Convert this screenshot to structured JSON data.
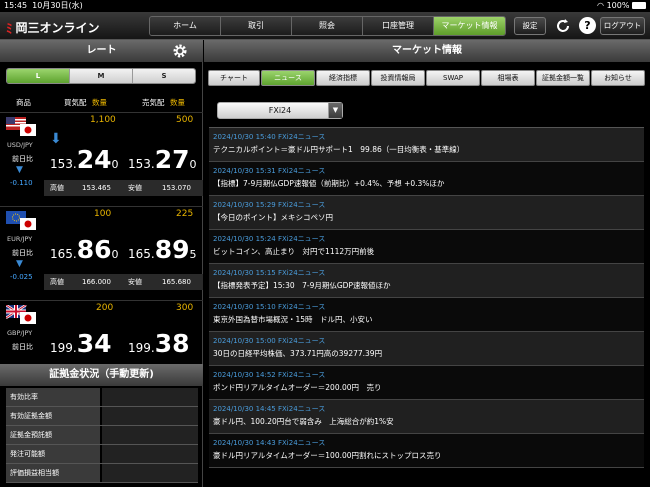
{
  "status_bar": {
    "time": "15:45",
    "date": "10月30日(水)",
    "battery": "100%"
  },
  "app": {
    "logo_text": "岡三オンライン"
  },
  "nav": {
    "tabs": [
      "ホーム",
      "取引",
      "照会",
      "口座管理",
      "マーケット情報"
    ],
    "active": "マーケット情報",
    "settings_label": "設定",
    "logout_label": "ログアウト"
  },
  "rate_panel": {
    "title": "レート",
    "size_tabs": [
      "L",
      "M",
      "S"
    ],
    "active_size": "L",
    "headers": {
      "product": "商品",
      "buy": "買気配",
      "buy_qty": "数量",
      "sell": "売気配",
      "sell_qty": "数量"
    },
    "pairs": [
      {
        "name": "USD/JPY",
        "zenjitsu": "前日比",
        "change": "-0.110",
        "buy_qty": "1,100",
        "sell_qty": "500",
        "buy": {
          "a": "153.",
          "b": "24",
          "c": "0"
        },
        "sell": {
          "a": "153.",
          "b": "27",
          "c": "0"
        },
        "high_label": "高値",
        "high": "153.465",
        "low_label": "安値",
        "low": "153.070"
      },
      {
        "name": "EUR/JPY",
        "zenjitsu": "前日比",
        "change": "-0.025",
        "buy_qty": "100",
        "sell_qty": "225",
        "buy": {
          "a": "165.",
          "b": "86",
          "c": "0"
        },
        "sell": {
          "a": "165.",
          "b": "89",
          "c": "5"
        },
        "high_label": "高値",
        "high": "166.000",
        "low_label": "安値",
        "low": "165.680"
      },
      {
        "name": "GBP/JPY",
        "zenjitsu": "前日比",
        "change": "",
        "buy_qty": "200",
        "sell_qty": "300",
        "buy": {
          "a": "199.",
          "b": "34",
          "c": ""
        },
        "sell": {
          "a": "199.",
          "b": "38",
          "c": ""
        }
      }
    ]
  },
  "margin_panel": {
    "title": "証拠金状況（手動更新)",
    "rows": [
      "有効比率",
      "有効証拠金額",
      "証拠金預託額",
      "発注可能額",
      "評価損益相当額"
    ]
  },
  "market": {
    "title": "マーケット情報",
    "subtabs": [
      "チャート",
      "ニュース",
      "経済指標",
      "投資情報局",
      "SWAP",
      "相場表",
      "証拠金額一覧",
      "お知らせ"
    ],
    "active_subtab": "ニュース",
    "source_select": "FXi24",
    "news": [
      {
        "meta": "2024/10/30 15:40 FXi24ニュース",
        "title": "テクニカルポイント＝豪ドル円サポート1　99.86（一目均衡表・基準線）"
      },
      {
        "meta": "2024/10/30 15:31 FXi24ニュース",
        "title": "【指標】7-9月期仏GDP速報値（前期比）+0.4%、予想 +0.3%ほか"
      },
      {
        "meta": "2024/10/30 15:29 FXi24ニュース",
        "title": "【今日のポイント】メキシコペソ円"
      },
      {
        "meta": "2024/10/30 15:24 FXi24ニュース",
        "title": "ビットコイン、高止まり　対円で1112万円前後"
      },
      {
        "meta": "2024/10/30 15:15 FXi24ニュース",
        "title": "【指標発表予定】15:30　7-9月期仏GDP速報値ほか"
      },
      {
        "meta": "2024/10/30 15:10 FXi24ニュース",
        "title": "東京外国為替市場概況・15時　ドル円、小安い"
      },
      {
        "meta": "2024/10/30 15:00 FXi24ニュース",
        "title": "30日の日経平均株価、373.71円高の39277.39円"
      },
      {
        "meta": "2024/10/30 14:52 FXi24ニュース",
        "title": "ポンド円リアルタイムオーダー＝200.00円　売り"
      },
      {
        "meta": "2024/10/30 14:45 FXi24ニュース",
        "title": "豪ドル円、100.20円台で弱含み　上海総合が約1%安"
      },
      {
        "meta": "2024/10/30 14:43 FXi24ニュース",
        "title": "豪ドル円リアルタイムオーダー＝100.00円割れにストップロス売り"
      }
    ]
  },
  "colors": {
    "accent_green": "#7dbb45",
    "buy_qty": "#e8b400",
    "news_meta": "#4a9cdb",
    "change_blue": "#46a8ff"
  }
}
